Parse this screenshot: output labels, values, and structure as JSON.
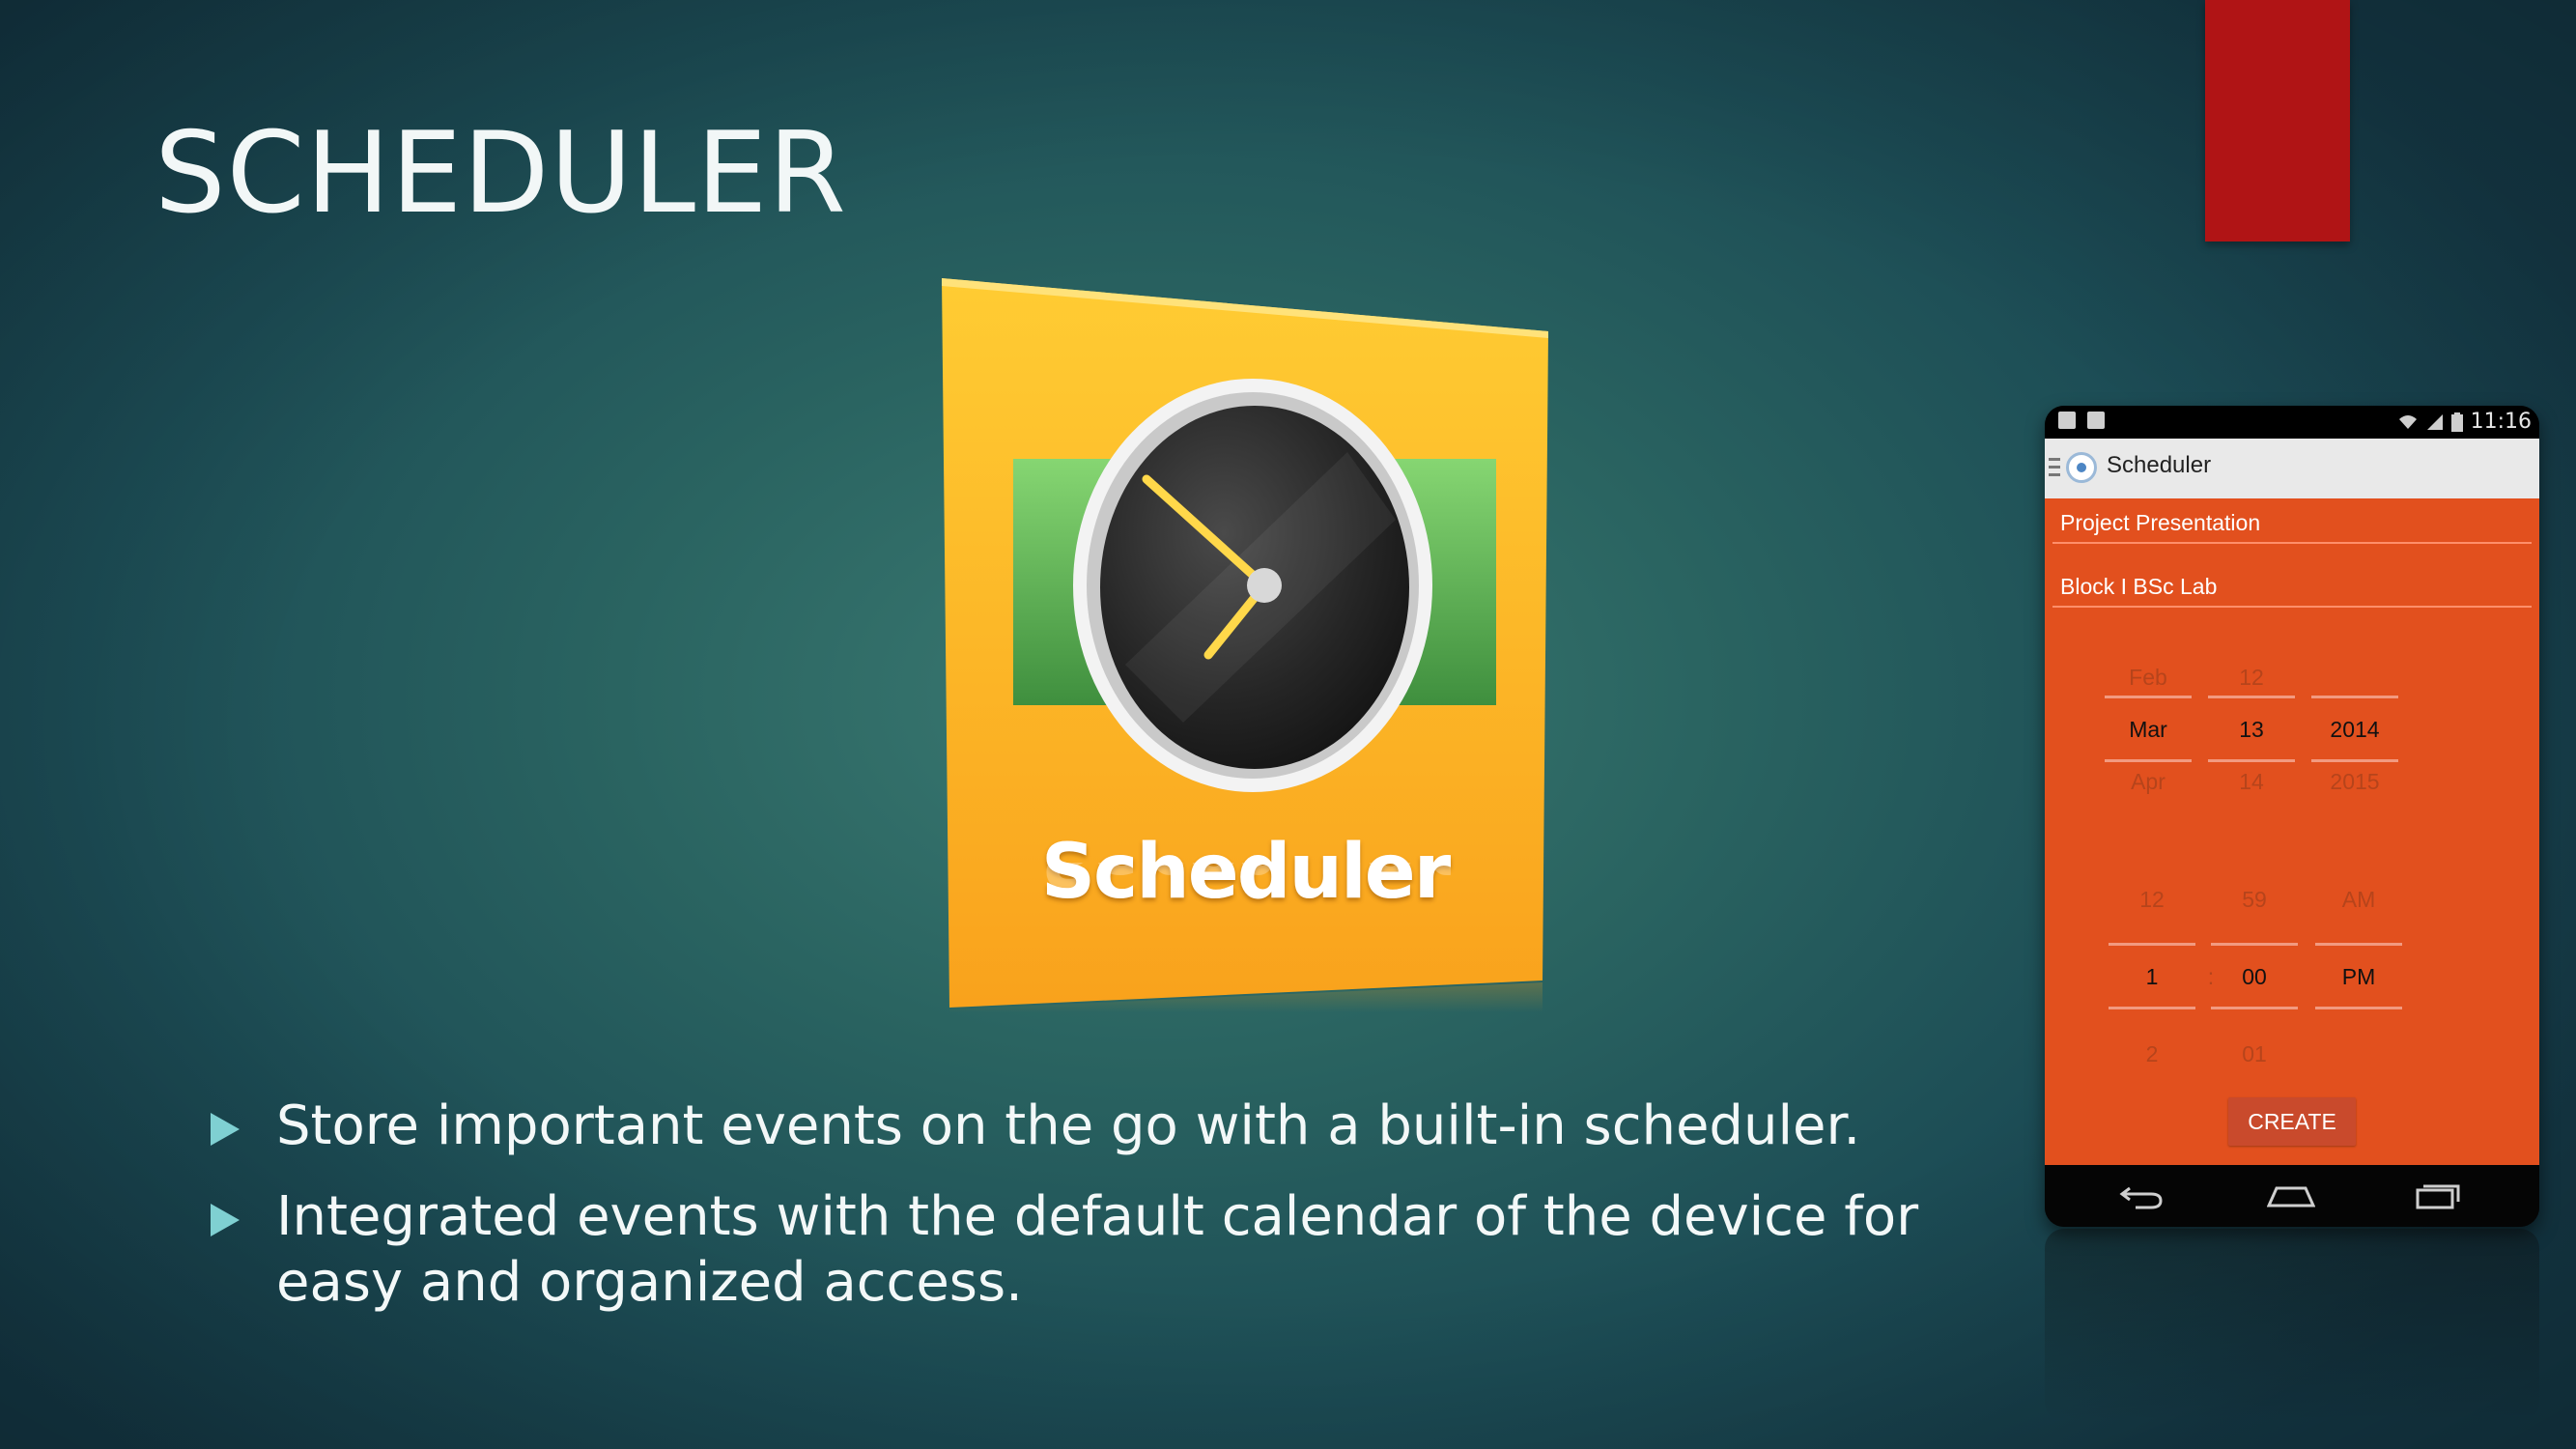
{
  "slide": {
    "title": "SCHEDULER",
    "bullets": [
      "Store important events on the go with a built-in scheduler.",
      "Integrated events with the default calendar of the device for easy and organized access."
    ]
  },
  "icon": {
    "label": "Scheduler",
    "icon_name": "clock-icon"
  },
  "phone": {
    "status_time": "11:16",
    "app_title": "Scheduler",
    "event_title": "Project Presentation",
    "event_location": "Block I BSc Lab",
    "date_picker": {
      "month": {
        "prev": "Feb",
        "selected": "Mar",
        "next": "Apr"
      },
      "day": {
        "prev": "12",
        "selected": "13",
        "next": "14"
      },
      "year": {
        "prev": "",
        "selected": "2014",
        "next": "2015"
      }
    },
    "time_picker": {
      "hour": {
        "prev": "12",
        "selected": "1",
        "next": "2"
      },
      "separator": ":",
      "minute": {
        "prev": "59",
        "selected": "00",
        "next": "01"
      },
      "ampm": {
        "prev": "AM",
        "selected": "PM",
        "next": ""
      }
    },
    "create_label": "CREATE"
  },
  "colors": {
    "accent_red": "#b01415",
    "phone_orange": "#e2501e",
    "icon_yellow": "#fdb62a"
  }
}
